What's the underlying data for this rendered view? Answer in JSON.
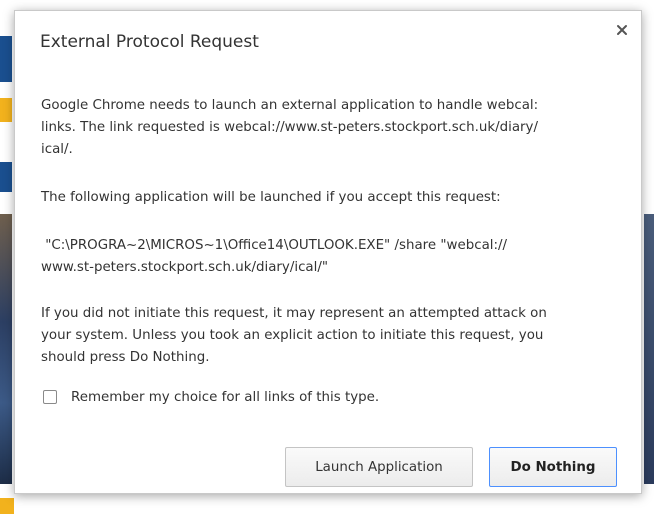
{
  "dialog": {
    "title": "External Protocol Request",
    "paragraph1_line1": "Google Chrome needs to launch an external application to handle webcal:",
    "paragraph1_line2": "links. The link requested is webcal://www.st-peters.stockport.sch.uk/diary/",
    "paragraph1_line3": "ical/.",
    "paragraph2": "The following application will be launched if you accept this request:",
    "command_line1": " \"C:\\PROGRA~2\\MICROS~1\\Office14\\OUTLOOK.EXE\" /share \"webcal://",
    "command_line2": "www.st-peters.stockport.sch.uk/diary/ical/\"",
    "warning_line1": "If you did not initiate this request, it may represent an attempted attack on",
    "warning_line2": "your system. Unless you took an explicit action to initiate this request, you",
    "warning_line3": "should press Do Nothing.",
    "remember_label": "Remember my choice for all links of this type.",
    "launch_button": "Launch Application",
    "do_nothing_button": "Do Nothing",
    "close_icon": "close-icon"
  },
  "colors": {
    "focus_border": "#4d90fe",
    "text": "#333333"
  }
}
